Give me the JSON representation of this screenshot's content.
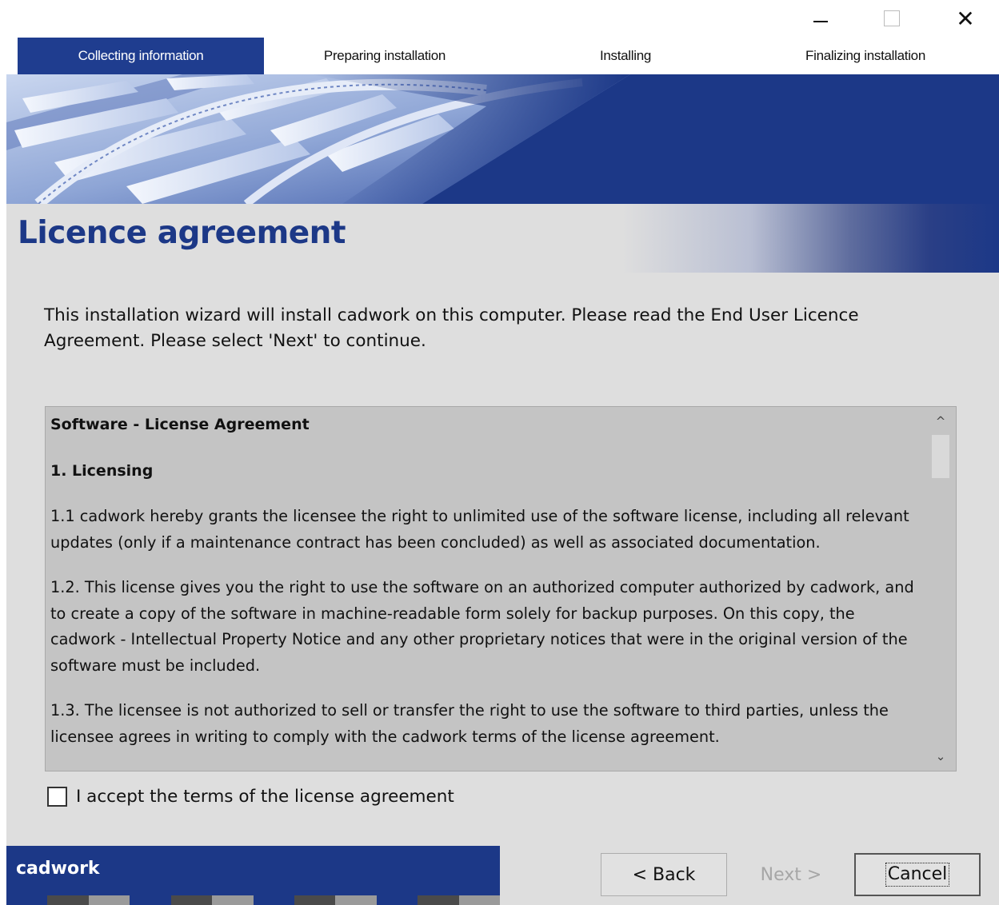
{
  "window": {
    "minimize_icon": "minimize-icon",
    "maximize_icon": "maximize-icon",
    "close_icon": "close-icon",
    "close_glyph": "✕"
  },
  "steps": [
    {
      "label": "Collecting information",
      "active": true
    },
    {
      "label": "Preparing installation",
      "active": false
    },
    {
      "label": "Installing",
      "active": false
    },
    {
      "label": "Finalizing installation",
      "active": false
    }
  ],
  "page": {
    "title": "Licence agreement",
    "intro": "This installation wizard will install cadwork on this computer. Please read the End User Licence Agreement. Please select 'Next' to continue."
  },
  "license": {
    "heading": "Software - License Agreement",
    "section": "1.  Licensing",
    "paragraphs": [
      "1.1  cadwork hereby grants the licensee the right to unlimited use of the software license, including all relevant updates (only if a maintenance contract has been concluded) as well as associated documentation.",
      "1.2. This license gives you the right to use the software on an authorized computer authorized by cadwork, and to create a copy of the software in machine-readable form solely for backup purposes. On this copy, the cadwork - Intellectual Property Notice and any other proprietary notices that were in the original version of the software must be included.",
      "1.3. The licensee is not authorized to sell or transfer the right to use the software to third parties, unless the licensee agrees in writing to comply with the cadwork terms of the license agreement."
    ],
    "scroll_up_glyph": "^",
    "scroll_down_glyph": "⌄"
  },
  "accept": {
    "label": "I accept the terms of the license agreement",
    "checked": false
  },
  "brand": {
    "name": "cadwork",
    "stripe_colors": [
      "#1c3887",
      "#4a4a4a",
      "#9a9a9a",
      "#1c3887",
      "#4a4a4a",
      "#9a9a9a",
      "#1c3887",
      "#4a4a4a",
      "#9a9a9a",
      "#1c3887",
      "#4a4a4a",
      "#9a9a9a"
    ]
  },
  "buttons": {
    "back": "< Back",
    "next": "Next >",
    "cancel": "Cancel"
  },
  "colors": {
    "accent": "#1c3887",
    "panel": "#dedede",
    "license_bg": "#c4c4c4"
  }
}
